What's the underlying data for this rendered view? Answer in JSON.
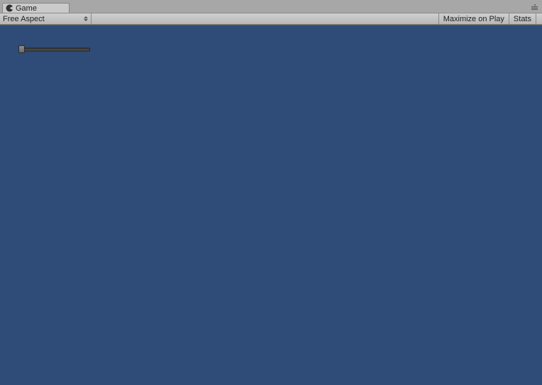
{
  "tab": {
    "label": "Game"
  },
  "toolbar": {
    "aspect_label": "Free Aspect",
    "maximize_label": "Maximize on Play",
    "stats_label": "Stats"
  },
  "slider": {
    "value": 0
  },
  "colors": {
    "viewport": "#2f4b77"
  }
}
